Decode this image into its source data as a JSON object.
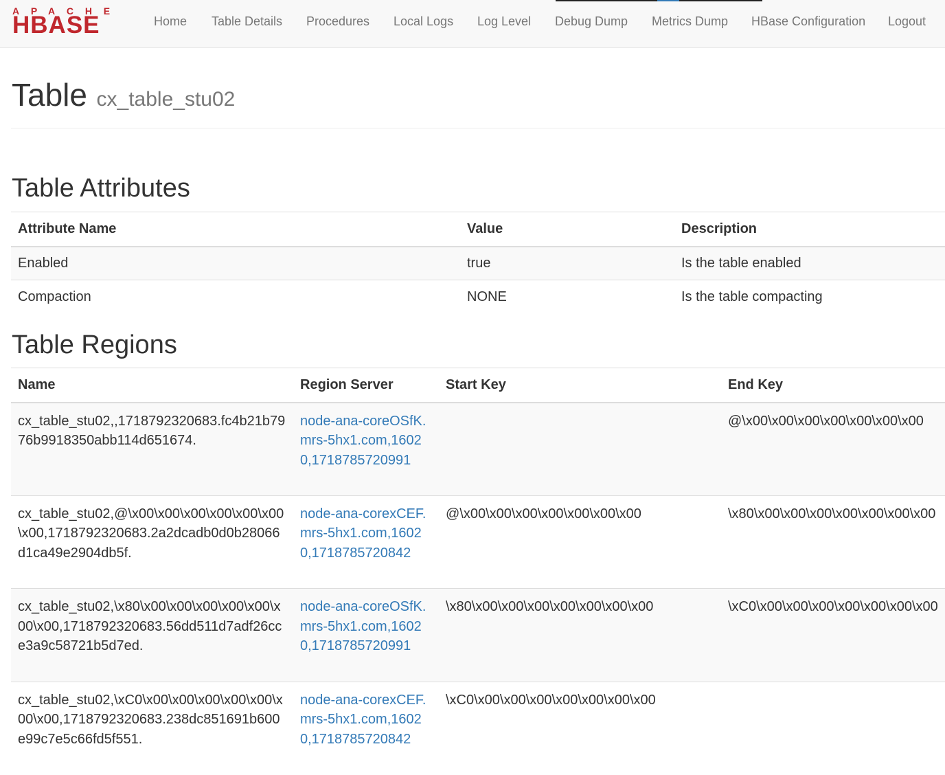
{
  "logo": {
    "top": "APACHE",
    "main": "HBASE"
  },
  "nav": {
    "items": [
      {
        "label": "Home"
      },
      {
        "label": "Table Details"
      },
      {
        "label": "Procedures"
      },
      {
        "label": "Local Logs"
      },
      {
        "label": "Log Level"
      },
      {
        "label": "Debug Dump"
      },
      {
        "label": "Metrics Dump"
      },
      {
        "label": "HBase Configuration"
      },
      {
        "label": "Logout"
      }
    ]
  },
  "page": {
    "title": "Table",
    "subtitle": "cx_table_stu02"
  },
  "attributes": {
    "heading": "Table Attributes",
    "columns": [
      "Attribute Name",
      "Value",
      "Description"
    ],
    "rows": [
      {
        "name": "Enabled",
        "value": "true",
        "description": "Is the table enabled"
      },
      {
        "name": "Compaction",
        "value": "NONE",
        "description": "Is the table compacting"
      }
    ]
  },
  "regions": {
    "heading": "Table Regions",
    "columns": [
      "Name",
      "Region Server",
      "Start Key",
      "End Key"
    ],
    "rows": [
      {
        "name": "cx_table_stu02,,1718792320683.fc4b21b7976b9918350abb114d651674.",
        "server": "node-ana-coreOSfK.mrs-5hx1.com,16020,1718785720991",
        "start_key": "",
        "end_key": "@\\x00\\x00\\x00\\x00\\x00\\x00\\x00"
      },
      {
        "name": "cx_table_stu02,@\\x00\\x00\\x00\\x00\\x00\\x00\\x00,1718792320683.2a2dcadb0d0b28066d1ca49e2904db5f.",
        "server": "node-ana-corexCEF.mrs-5hx1.com,16020,1718785720842",
        "start_key": "@\\x00\\x00\\x00\\x00\\x00\\x00\\x00",
        "end_key": "\\x80\\x00\\x00\\x00\\x00\\x00\\x00\\x00"
      },
      {
        "name": "cx_table_stu02,\\x80\\x00\\x00\\x00\\x00\\x00\\x00\\x00,1718792320683.56dd511d7adf26cce3a9c58721b5d7ed.",
        "server": "node-ana-coreOSfK.mrs-5hx1.com,16020,1718785720991",
        "start_key": "\\x80\\x00\\x00\\x00\\x00\\x00\\x00\\x00",
        "end_key": "\\xC0\\x00\\x00\\x00\\x00\\x00\\x00\\x00"
      },
      {
        "name": "cx_table_stu02,\\xC0\\x00\\x00\\x00\\x00\\x00\\x00\\x00,1718792320683.238dc851691b600e99c7e5c66fd5f551.",
        "server": "node-ana-corexCEF.mrs-5hx1.com,16020,1718785720842",
        "start_key": "\\xC0\\x00\\x00\\x00\\x00\\x00\\x00\\x00",
        "end_key": ""
      }
    ]
  },
  "colors": {
    "brand": "#c0272d",
    "link": "#337ab7",
    "nav_text": "#777777"
  }
}
